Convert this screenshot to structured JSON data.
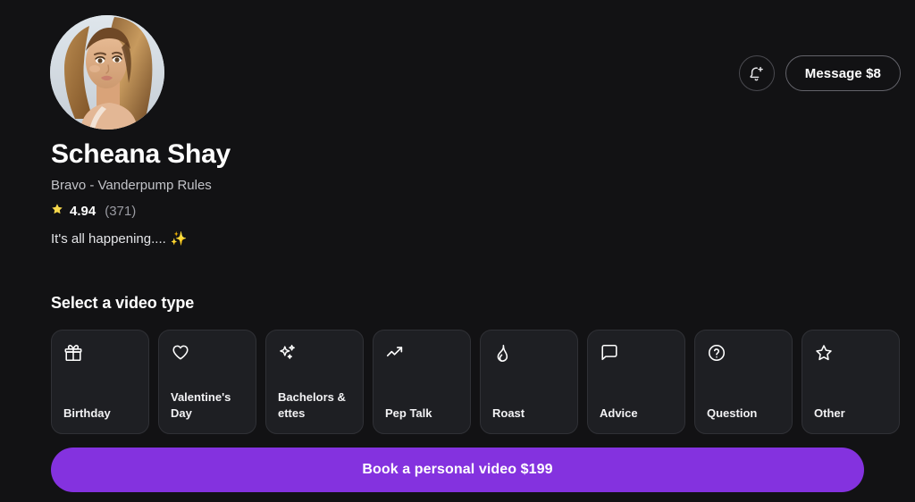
{
  "theme": {
    "background": "#121214",
    "card_background": "#1e1f23",
    "card_border": "#303136",
    "accent_purple": "#8432df",
    "star_yellow": "#f7d84b",
    "text_primary": "#ffffff",
    "text_secondary": "#c2c3c8",
    "text_muted": "#9a9ba2"
  },
  "header": {
    "notify_icon": "bell-plus-icon",
    "message_label": "Message $8"
  },
  "profile": {
    "avatar_icon": "profile-photo",
    "name": "Scheana Shay",
    "subtitle": "Bravo - Vanderpump Rules",
    "star_icon": "star-filled-icon",
    "rating_value": "4.94",
    "rating_count": "(371)",
    "tagline": "It's all happening....",
    "tagline_emoji": "✨"
  },
  "video_types": {
    "section_title": "Select a video type",
    "items": [
      {
        "label": "Birthday",
        "icon": "gift-icon"
      },
      {
        "label": "Valentine's Day",
        "icon": "heart-icon"
      },
      {
        "label": "Bachelors & ettes",
        "icon": "sparkles-icon"
      },
      {
        "label": "Pep Talk",
        "icon": "trending-up-icon"
      },
      {
        "label": "Roast",
        "icon": "flame-icon"
      },
      {
        "label": "Advice",
        "icon": "message-square-icon"
      },
      {
        "label": "Question",
        "icon": "help-circle-icon"
      },
      {
        "label": "Other",
        "icon": "star-outline-icon"
      }
    ]
  },
  "cta": {
    "label": "Book a personal video $199"
  }
}
